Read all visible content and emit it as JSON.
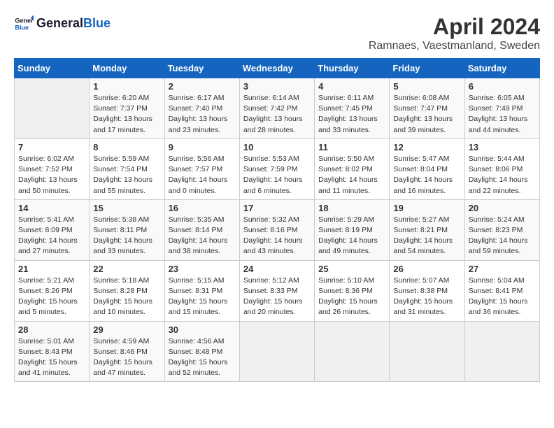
{
  "header": {
    "logo_line1": "General",
    "logo_line2": "Blue",
    "month_year": "April 2024",
    "location": "Ramnaes, Vaestmanland, Sweden"
  },
  "weekdays": [
    "Sunday",
    "Monday",
    "Tuesday",
    "Wednesday",
    "Thursday",
    "Friday",
    "Saturday"
  ],
  "weeks": [
    [
      {
        "day": "",
        "info": ""
      },
      {
        "day": "1",
        "info": "Sunrise: 6:20 AM\nSunset: 7:37 PM\nDaylight: 13 hours\nand 17 minutes."
      },
      {
        "day": "2",
        "info": "Sunrise: 6:17 AM\nSunset: 7:40 PM\nDaylight: 13 hours\nand 23 minutes."
      },
      {
        "day": "3",
        "info": "Sunrise: 6:14 AM\nSunset: 7:42 PM\nDaylight: 13 hours\nand 28 minutes."
      },
      {
        "day": "4",
        "info": "Sunrise: 6:11 AM\nSunset: 7:45 PM\nDaylight: 13 hours\nand 33 minutes."
      },
      {
        "day": "5",
        "info": "Sunrise: 6:08 AM\nSunset: 7:47 PM\nDaylight: 13 hours\nand 39 minutes."
      },
      {
        "day": "6",
        "info": "Sunrise: 6:05 AM\nSunset: 7:49 PM\nDaylight: 13 hours\nand 44 minutes."
      }
    ],
    [
      {
        "day": "7",
        "info": "Sunrise: 6:02 AM\nSunset: 7:52 PM\nDaylight: 13 hours\nand 50 minutes."
      },
      {
        "day": "8",
        "info": "Sunrise: 5:59 AM\nSunset: 7:54 PM\nDaylight: 13 hours\nand 55 minutes."
      },
      {
        "day": "9",
        "info": "Sunrise: 5:56 AM\nSunset: 7:57 PM\nDaylight: 14 hours\nand 0 minutes."
      },
      {
        "day": "10",
        "info": "Sunrise: 5:53 AM\nSunset: 7:59 PM\nDaylight: 14 hours\nand 6 minutes."
      },
      {
        "day": "11",
        "info": "Sunrise: 5:50 AM\nSunset: 8:02 PM\nDaylight: 14 hours\nand 11 minutes."
      },
      {
        "day": "12",
        "info": "Sunrise: 5:47 AM\nSunset: 8:04 PM\nDaylight: 14 hours\nand 16 minutes."
      },
      {
        "day": "13",
        "info": "Sunrise: 5:44 AM\nSunset: 8:06 PM\nDaylight: 14 hours\nand 22 minutes."
      }
    ],
    [
      {
        "day": "14",
        "info": "Sunrise: 5:41 AM\nSunset: 8:09 PM\nDaylight: 14 hours\nand 27 minutes."
      },
      {
        "day": "15",
        "info": "Sunrise: 5:38 AM\nSunset: 8:11 PM\nDaylight: 14 hours\nand 33 minutes."
      },
      {
        "day": "16",
        "info": "Sunrise: 5:35 AM\nSunset: 8:14 PM\nDaylight: 14 hours\nand 38 minutes."
      },
      {
        "day": "17",
        "info": "Sunrise: 5:32 AM\nSunset: 8:16 PM\nDaylight: 14 hours\nand 43 minutes."
      },
      {
        "day": "18",
        "info": "Sunrise: 5:29 AM\nSunset: 8:19 PM\nDaylight: 14 hours\nand 49 minutes."
      },
      {
        "day": "19",
        "info": "Sunrise: 5:27 AM\nSunset: 8:21 PM\nDaylight: 14 hours\nand 54 minutes."
      },
      {
        "day": "20",
        "info": "Sunrise: 5:24 AM\nSunset: 8:23 PM\nDaylight: 14 hours\nand 59 minutes."
      }
    ],
    [
      {
        "day": "21",
        "info": "Sunrise: 5:21 AM\nSunset: 8:26 PM\nDaylight: 15 hours\nand 5 minutes."
      },
      {
        "day": "22",
        "info": "Sunrise: 5:18 AM\nSunset: 8:28 PM\nDaylight: 15 hours\nand 10 minutes."
      },
      {
        "day": "23",
        "info": "Sunrise: 5:15 AM\nSunset: 8:31 PM\nDaylight: 15 hours\nand 15 minutes."
      },
      {
        "day": "24",
        "info": "Sunrise: 5:12 AM\nSunset: 8:33 PM\nDaylight: 15 hours\nand 20 minutes."
      },
      {
        "day": "25",
        "info": "Sunrise: 5:10 AM\nSunset: 8:36 PM\nDaylight: 15 hours\nand 26 minutes."
      },
      {
        "day": "26",
        "info": "Sunrise: 5:07 AM\nSunset: 8:38 PM\nDaylight: 15 hours\nand 31 minutes."
      },
      {
        "day": "27",
        "info": "Sunrise: 5:04 AM\nSunset: 8:41 PM\nDaylight: 15 hours\nand 36 minutes."
      }
    ],
    [
      {
        "day": "28",
        "info": "Sunrise: 5:01 AM\nSunset: 8:43 PM\nDaylight: 15 hours\nand 41 minutes."
      },
      {
        "day": "29",
        "info": "Sunrise: 4:59 AM\nSunset: 8:46 PM\nDaylight: 15 hours\nand 47 minutes."
      },
      {
        "day": "30",
        "info": "Sunrise: 4:56 AM\nSunset: 8:48 PM\nDaylight: 15 hours\nand 52 minutes."
      },
      {
        "day": "",
        "info": ""
      },
      {
        "day": "",
        "info": ""
      },
      {
        "day": "",
        "info": ""
      },
      {
        "day": "",
        "info": ""
      }
    ]
  ]
}
